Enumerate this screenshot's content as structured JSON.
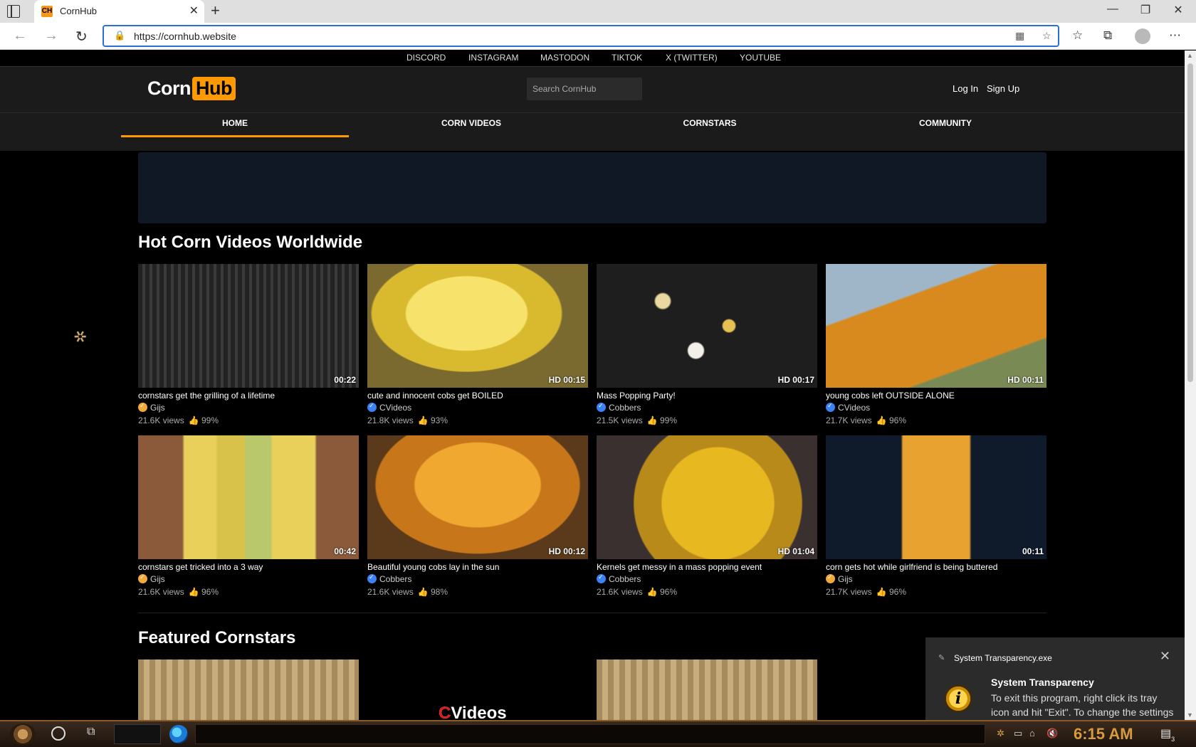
{
  "browser": {
    "tab_title": "CornHub",
    "favicon_text": "CH",
    "url": "https://cornhub.website"
  },
  "social_links": [
    "DISCORD",
    "INSTAGRAM",
    "MASTODON",
    "TIKTOK",
    "X (TWITTER)",
    "YOUTUBE"
  ],
  "header": {
    "logo_corn": "Corn",
    "logo_hub": "Hub",
    "search_placeholder": "Search CornHub",
    "login": "Log In",
    "signup": "Sign Up"
  },
  "nav": [
    "HOME",
    "CORN VIDEOS",
    "CORNSTARS",
    "COMMUNITY"
  ],
  "nav_active": "HOME",
  "sections": {
    "hot": "Hot Corn Videos Worldwide",
    "featured": "Featured Cornstars"
  },
  "videos": [
    {
      "title": "cornstars get the grilling of a lifetime",
      "channel": "Gijs",
      "channel_color": "#f2a93b",
      "views": "21.6K views",
      "rating": "99%",
      "duration": "00:22",
      "thumb": "grill"
    },
    {
      "title": "cute and innocent cobs get BOILED",
      "channel": "CVideos",
      "channel_color": "#3b82f6",
      "views": "21.8K views",
      "rating": "93%",
      "duration": "HD 00:15",
      "thumb": "boil"
    },
    {
      "title": "Mass Popping Party!",
      "channel": "Cobbers",
      "channel_color": "#3b82f6",
      "views": "21.5K views",
      "rating": "99%",
      "duration": "HD 00:17",
      "thumb": "pop"
    },
    {
      "title": "young cobs left OUTSIDE ALONE",
      "channel": "CVideos",
      "channel_color": "#3b82f6",
      "views": "21.7K views",
      "rating": "96%",
      "duration": "HD 00:11",
      "thumb": "hang"
    },
    {
      "title": "cornstars get tricked into a 3 way",
      "channel": "Gijs",
      "channel_color": "#f2a93b",
      "views": "21.6K views",
      "rating": "96%",
      "duration": "00:42",
      "thumb": "three"
    },
    {
      "title": "Beautiful young cobs lay in the sun",
      "channel": "Cobbers",
      "channel_color": "#3b82f6",
      "views": "21.6K views",
      "rating": "98%",
      "duration": "HD 00:12",
      "thumb": "basket"
    },
    {
      "title": "Kernels get messy in a mass popping event",
      "channel": "Cobbers",
      "channel_color": "#3b82f6",
      "views": "21.6K views",
      "rating": "96%",
      "duration": "HD 01:04",
      "thumb": "pot"
    },
    {
      "title": "corn gets hot while girlfriend is being buttered",
      "channel": "Gijs",
      "channel_color": "#f2a93b",
      "views": "21.7K views",
      "rating": "96%",
      "duration": "00:11",
      "thumb": "charred"
    }
  ],
  "featured_cornstars": [
    {
      "label": ""
    },
    {
      "label": "CVideos"
    },
    {
      "label": ""
    }
  ],
  "toast": {
    "app": "System Transparency.exe",
    "title": "System Transparency",
    "body": "To exit this program, right click its tray icon and hit \"Exit\". To change the settings of the program, right click the icon and select"
  },
  "taskbar": {
    "clock": "6:15 AM",
    "notif_count": "3"
  },
  "colors": {
    "accent": "#ff9900",
    "ad_bg": "#101826",
    "header_bg": "#1b1b1b",
    "address_border": "#2a6fd6"
  }
}
